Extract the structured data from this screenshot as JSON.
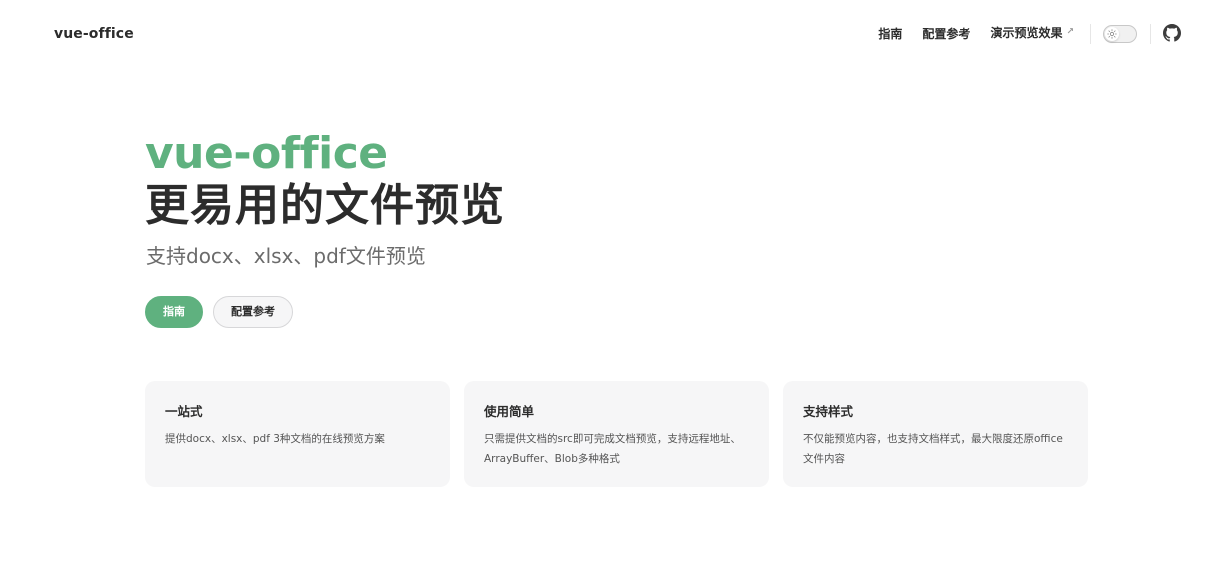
{
  "nav": {
    "brand": "vue-office",
    "links": [
      {
        "label": "指南"
      },
      {
        "label": "配置参考"
      },
      {
        "label": "演示预览效果",
        "external_icon": "↗"
      }
    ]
  },
  "hero": {
    "name": "vue-office",
    "text": "更易用的文件预览",
    "tagline": "支持docx、xlsx、pdf文件预览",
    "actions": [
      {
        "label": "指南"
      },
      {
        "label": "配置参考"
      }
    ]
  },
  "features": [
    {
      "title": "一站式",
      "details": "提供docx、xlsx、pdf 3种文档的在线预览方案"
    },
    {
      "title": "使用简单",
      "details": "只需提供文档的src即可完成文档预览，支持远程地址、ArrayBuffer、Blob多种格式"
    },
    {
      "title": "支持样式",
      "details": "不仅能预览内容，也支持文档样式，最大限度还原office文件内容"
    }
  ],
  "colors": {
    "brand": "#5fb17f",
    "text": "#2c2c2c",
    "card_bg": "#f6f6f7"
  },
  "icons": {
    "theme_toggle": "sun-icon",
    "repo": "github-icon"
  }
}
